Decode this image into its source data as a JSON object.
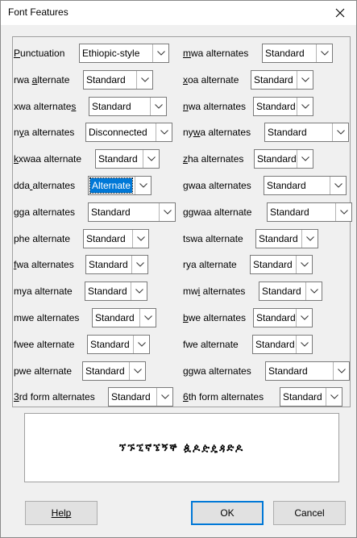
{
  "window": {
    "title": "Font Features"
  },
  "features": [
    {
      "label": "Punctuation",
      "mn": 0,
      "value": "Ethiopic-style"
    },
    {
      "label": "mwa alternates",
      "mn": 0,
      "value": "Standard"
    },
    {
      "label": "rwa alternate",
      "mn": 4,
      "value": "Standard"
    },
    {
      "label": "xoa alternate",
      "mn": 0,
      "value": "Standard"
    },
    {
      "label": "xwa alternates",
      "mn": 13,
      "value": "Standard"
    },
    {
      "label": "nwa alternates",
      "mn": 0,
      "value": "Standard"
    },
    {
      "label": "nya alternates",
      "mn": 1,
      "value": "Disconnected"
    },
    {
      "label": "nywa alternates",
      "mn": 2,
      "value": "Standard"
    },
    {
      "label": "kxwaa alternate",
      "mn": 0,
      "value": "Standard"
    },
    {
      "label": "zha alternates",
      "mn": 0,
      "value": "Standard"
    },
    {
      "label": "dda alternates",
      "mn": 3,
      "value": "Alternate",
      "selected": true
    },
    {
      "label": "gwaa alternates",
      "mn": 0,
      "value": "Standard"
    },
    {
      "label": "gga alternates",
      "mn": null,
      "value": "Standard"
    },
    {
      "label": "ggwaa alternate",
      "mn": null,
      "value": "Standard"
    },
    {
      "label": "phe alternate",
      "mn": null,
      "value": "Standard"
    },
    {
      "label": "tswa alternate",
      "mn": null,
      "value": "Standard"
    },
    {
      "label": "fwa alternates",
      "mn": 0,
      "value": "Standard"
    },
    {
      "label": "rya alternate",
      "mn": null,
      "value": "Standard"
    },
    {
      "label": "mya alternate",
      "mn": null,
      "value": "Standard"
    },
    {
      "label": "mwi alternates",
      "mn": 2,
      "value": "Standard"
    },
    {
      "label": "mwe alternates",
      "mn": null,
      "value": "Standard"
    },
    {
      "label": "bwe alternates",
      "mn": 0,
      "value": "Standard"
    },
    {
      "label": "fwee alternate",
      "mn": null,
      "value": "Standard"
    },
    {
      "label": "fwe alternate",
      "mn": null,
      "value": "Standard"
    },
    {
      "label": "pwe alternate",
      "mn": null,
      "value": "Standard"
    },
    {
      "label": "ggwa alternates",
      "mn": null,
      "value": "Standard"
    },
    {
      "label": "3rd form alternates",
      "mn": 0,
      "value": "Standard"
    },
    {
      "label": "6th form alternates",
      "mn": 0,
      "value": "Standard"
    }
  ],
  "preview": {
    "text": "ኘኙኚኛኜኝኞ ዿዾዽዼዻድዾ"
  },
  "buttons": {
    "help": "Help",
    "ok": "OK",
    "cancel": "Cancel"
  }
}
